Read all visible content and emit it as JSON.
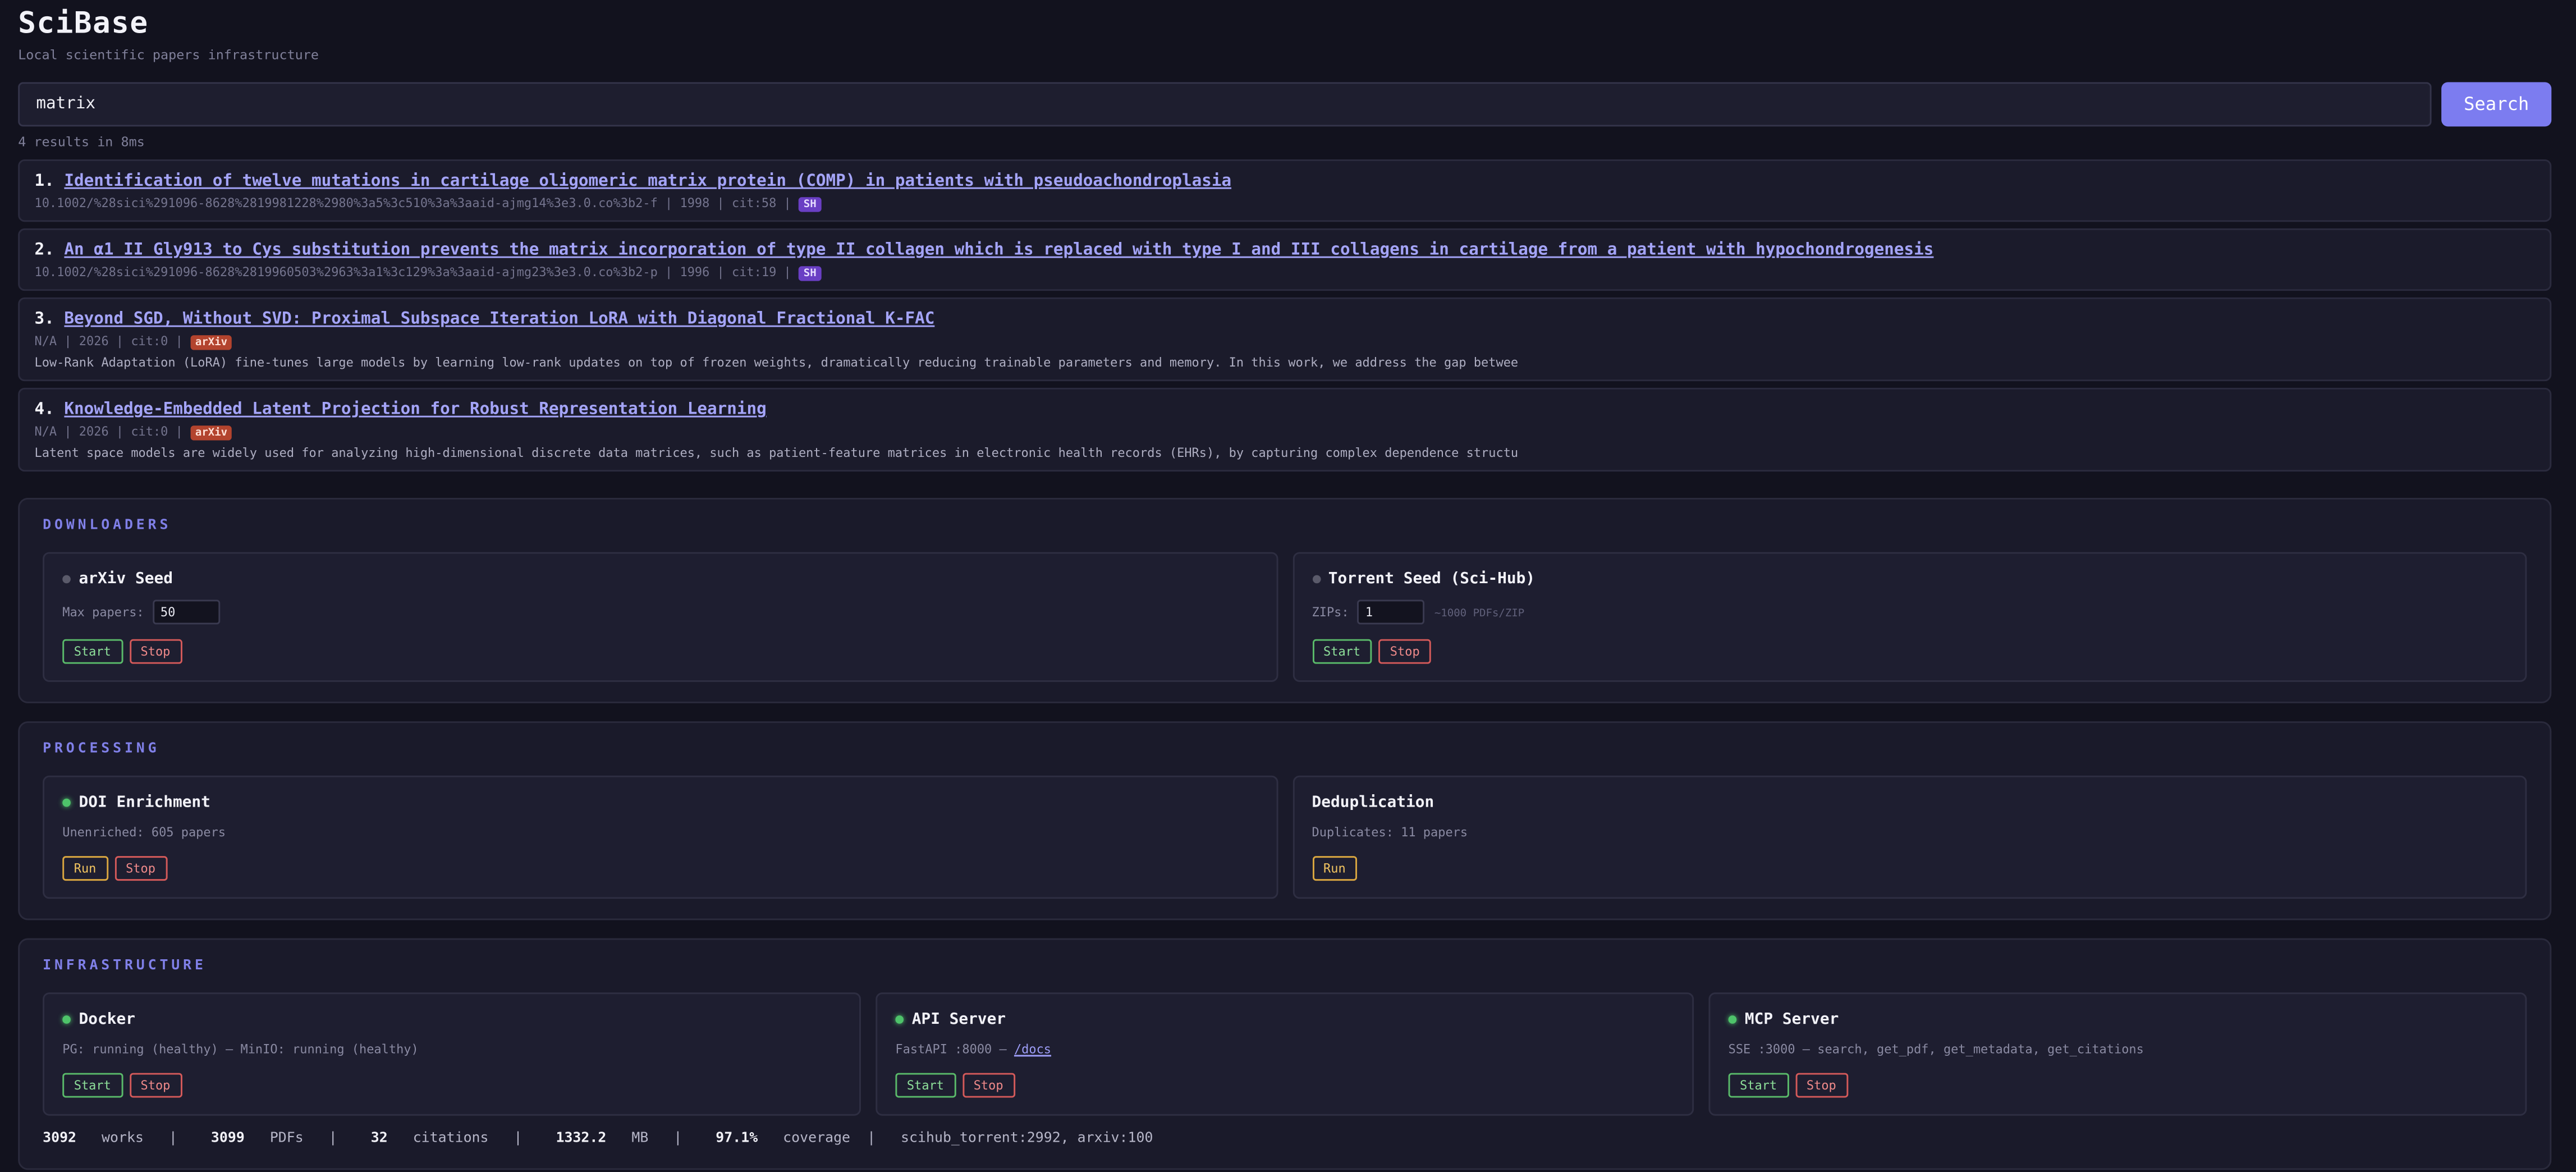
{
  "app": {
    "title": "SciBase",
    "subtitle": "Local scientific papers infrastructure"
  },
  "search": {
    "query": "matrix",
    "button_label": "Search",
    "results_meta": "4 results in 8ms"
  },
  "results": [
    {
      "number": "1.",
      "title": "Identification of twelve mutations in cartilage oligomeric matrix protein (COMP) in patients with pseudoachondroplasia",
      "meta": "10.1002/%28sici%291096-8628%2819981228%2980%3a5%3c510%3a%3aaid-ajmg14%3e3.0.co%3b2-f | 1998 | cit:58 | ",
      "badge": "SH",
      "abstract": ""
    },
    {
      "number": "2.",
      "title": "An α1 II Gly913 to Cys substitution prevents the matrix incorporation of type II collagen which is replaced with type I and III collagens in cartilage from a patient with hypochondrogenesis",
      "meta": "10.1002/%28sici%291096-8628%2819960503%2963%3a1%3c129%3a%3aaid-ajmg23%3e3.0.co%3b2-p | 1996 | cit:19 | ",
      "badge": "SH",
      "abstract": ""
    },
    {
      "number": "3.",
      "title": "Beyond SGD, Without SVD: Proximal Subspace Iteration LoRA with Diagonal Fractional K-FAC",
      "meta": "N/A | 2026 | cit:0 | ",
      "badge": "arXiv",
      "abstract": "Low-Rank Adaptation (LoRA) fine-tunes large models by learning low-rank updates on top of frozen weights, dramatically reducing trainable parameters and memory. In this work, we address the gap betwee"
    },
    {
      "number": "4.",
      "title": "Knowledge-Embedded Latent Projection for Robust Representation Learning",
      "meta": "N/A | 2026 | cit:0 | ",
      "badge": "arXiv",
      "abstract": "Latent space models are widely used for analyzing high-dimensional discrete data matrices, such as patient-feature matrices in electronic health records (EHRs), by capturing complex dependence structu"
    }
  ],
  "downloaders": {
    "title": "DOWNLOADERS",
    "arxiv": {
      "name": "arXiv Seed",
      "field_label": "Max papers:",
      "field_value": "50",
      "start": "Start",
      "stop": "Stop",
      "status_color": "#5a5a6a"
    },
    "torrent": {
      "name": "Torrent Seed (Sci-Hub)",
      "field_label": "ZIPs:",
      "field_value": "1",
      "hint": "~1000 PDFs/ZIP",
      "start": "Start",
      "stop": "Stop",
      "status_color": "#5a5a6a"
    }
  },
  "processing": {
    "title": "PROCESSING",
    "doi": {
      "name": "DOI Enrichment",
      "desc": "Unenriched: 605 papers",
      "run": "Run",
      "stop": "Stop",
      "status_color": "#4ec36a"
    },
    "dedup": {
      "name": "Deduplication",
      "desc": "Duplicates: 11 papers",
      "run": "Run"
    }
  },
  "infrastructure": {
    "title": "INFRASTRUCTURE",
    "docker": {
      "name": "Docker",
      "desc": "PG: running (healthy) — MinIO: running (healthy)",
      "start": "Start",
      "stop": "Stop",
      "status_color": "#4ec36a"
    },
    "api": {
      "name": "API Server",
      "desc_prefix": "FastAPI :8000 — ",
      "docs_link": "/docs",
      "start": "Start",
      "stop": "Stop",
      "status_color": "#4ec36a"
    },
    "mcp": {
      "name": "MCP Server",
      "desc": "SSE :3000 — search, get_pdf, get_metadata, get_citations",
      "start": "Start",
      "stop": "Stop",
      "status_color": "#4ec36a"
    }
  },
  "stats": {
    "works_value": "3092",
    "works_label": "works",
    "pdfs_value": "3099",
    "pdfs_label": "PDFs",
    "citations_value": "32",
    "citations_label": "citations",
    "mb_value": "1332.2",
    "mb_label": "MB",
    "coverage_value": "97.1%",
    "coverage_label": "coverage",
    "sources": "scihub_torrent:2992, arxiv:100",
    "separator": "|"
  }
}
